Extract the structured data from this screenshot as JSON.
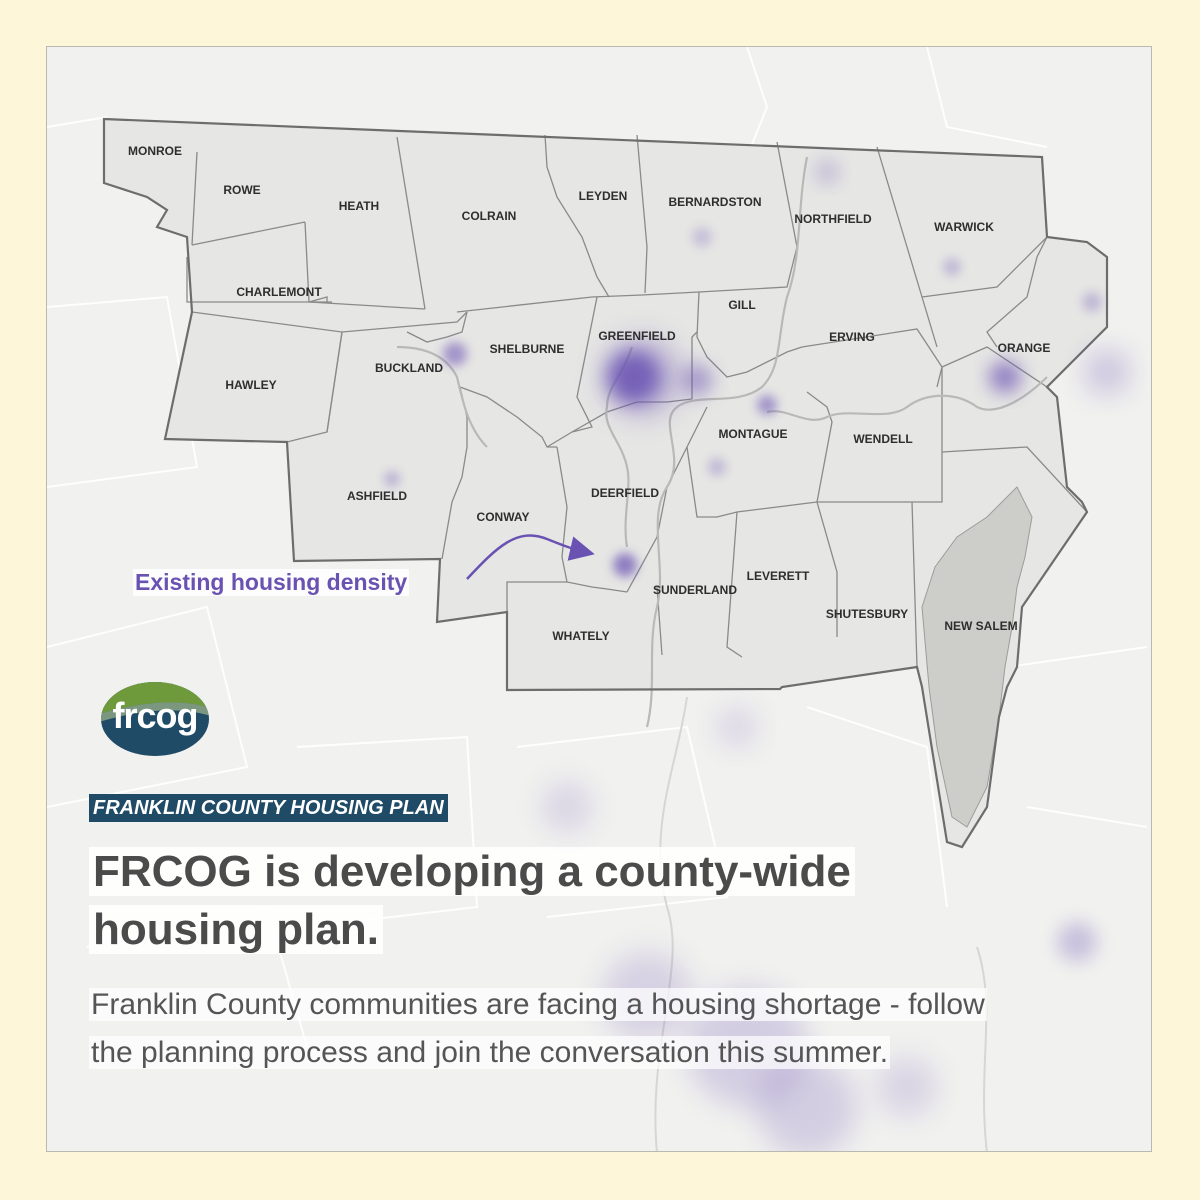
{
  "map": {
    "towns": [
      {
        "id": "monroe",
        "name": "MONROE"
      },
      {
        "id": "rowe",
        "name": "ROWE"
      },
      {
        "id": "heath",
        "name": "HEATH"
      },
      {
        "id": "colrain",
        "name": "COLRAIN"
      },
      {
        "id": "leyden",
        "name": "LEYDEN"
      },
      {
        "id": "bernardston",
        "name": "BERNARDSTON"
      },
      {
        "id": "northfield",
        "name": "NORTHFIELD"
      },
      {
        "id": "warwick",
        "name": "WARWICK"
      },
      {
        "id": "charlemont",
        "name": "CHARLEMONT"
      },
      {
        "id": "gill",
        "name": "GILL"
      },
      {
        "id": "greenfield",
        "name": "GREENFIELD"
      },
      {
        "id": "shelburne",
        "name": "SHELBURNE"
      },
      {
        "id": "erving",
        "name": "ERVING"
      },
      {
        "id": "orange",
        "name": "ORANGE"
      },
      {
        "id": "buckland",
        "name": "BUCKLAND"
      },
      {
        "id": "hawley",
        "name": "HAWLEY"
      },
      {
        "id": "montague",
        "name": "MONTAGUE"
      },
      {
        "id": "wendell",
        "name": "WENDELL"
      },
      {
        "id": "ashfield",
        "name": "ASHFIELD"
      },
      {
        "id": "deerfield",
        "name": "DEERFIELD"
      },
      {
        "id": "conway",
        "name": "CONWAY"
      },
      {
        "id": "sunderland",
        "name": "SUNDERLAND"
      },
      {
        "id": "leverett",
        "name": "LEVERETT"
      },
      {
        "id": "shutesbury",
        "name": "SHUTESBURY"
      },
      {
        "id": "new_salem",
        "name": "NEW SALEM"
      },
      {
        "id": "whately",
        "name": "WHATELY"
      }
    ],
    "annotation": "Existing housing density",
    "colors": {
      "county_fill": "#e6e6e4",
      "boundary": "#6d6d6d",
      "density": "#6a52b3",
      "background": "#f1f1ef",
      "page": "#fdf6d8"
    }
  },
  "logo": {
    "text": "frcog",
    "colors": {
      "top": "#6f9a3c",
      "bottom": "#1f4b67"
    }
  },
  "kicker": "FRANKLIN COUNTY HOUSING PLAN",
  "headline": "FRCOG is developing a county-wide housing plan.",
  "body": "Franklin County communities are facing a housing shortage - follow the planning process and join the conversation this summer."
}
